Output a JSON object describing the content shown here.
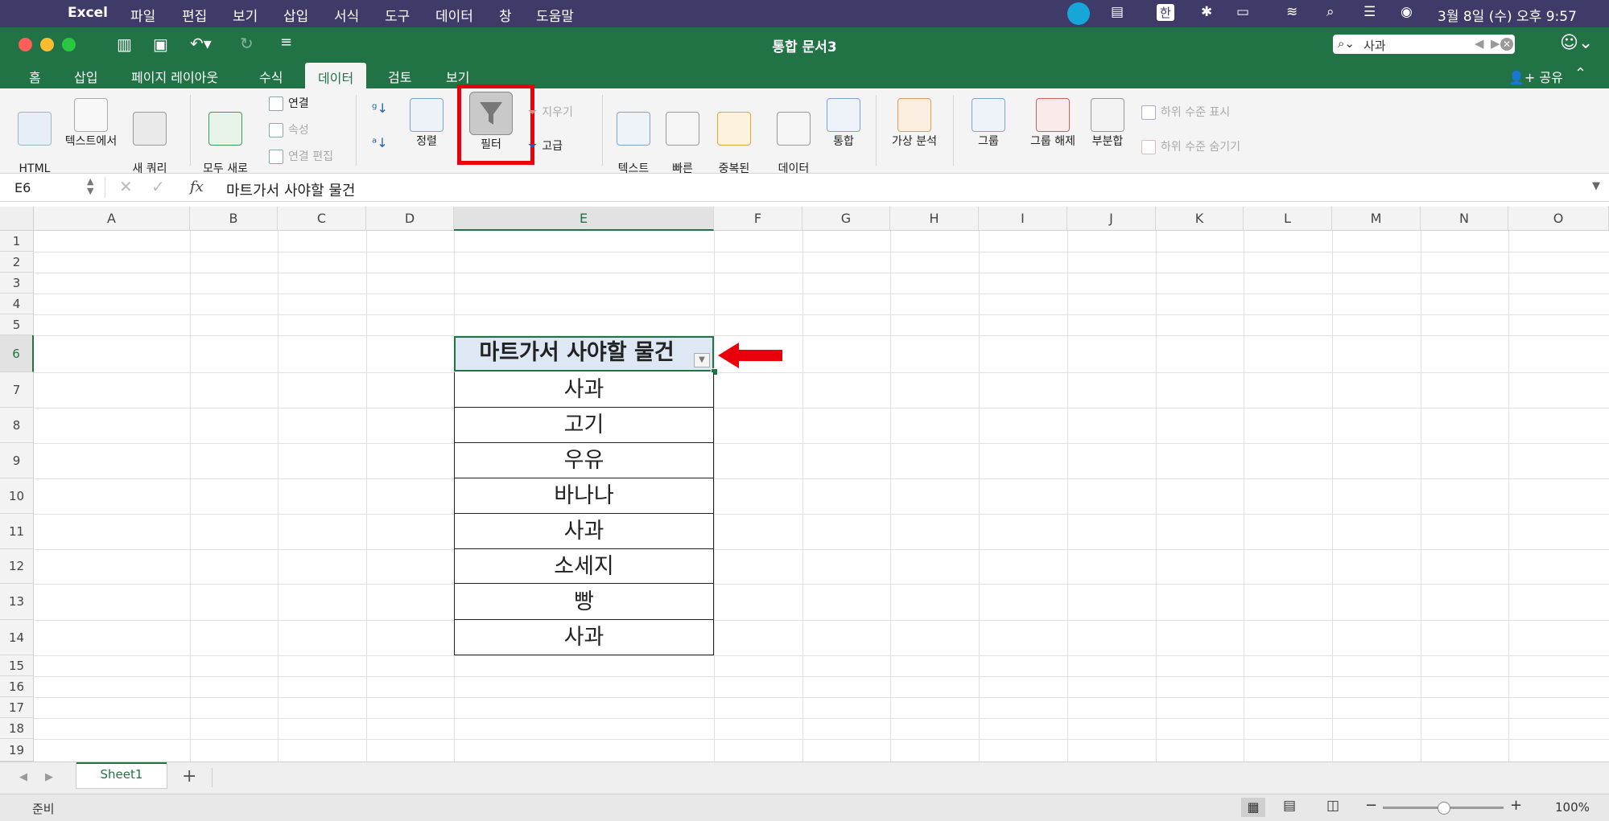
{
  "menubar": {
    "apple": "",
    "app": "Excel",
    "items": [
      "파일",
      "편집",
      "보기",
      "삽입",
      "서식",
      "도구",
      "데이터",
      "창",
      "도움말"
    ],
    "input_icon_label": "한",
    "clock": "3월 8일 (수) 오후 9:57"
  },
  "window": {
    "title": "통합 문서3",
    "search_value": "사과"
  },
  "tabs": {
    "items": [
      "홈",
      "삽입",
      "페이지 레이아웃",
      "수식",
      "데이터",
      "검토",
      "보기"
    ],
    "active": "데이터",
    "share_label": "공유"
  },
  "ribbon": {
    "html_label": "HTML\n에서",
    "text_label": "텍스트에서",
    "new_query_label": "새 쿼리\n만들기",
    "refresh_all_label": "모두 새로\n고침",
    "connections_label": "연결",
    "properties_label": "속성",
    "edit_links_label": "연결 편집",
    "sort_label": "정렬",
    "filter_label": "필터",
    "clear_label": "지우기",
    "advanced_label": "고급",
    "text_to_columns_label": "텍스트\n나누기",
    "flash_fill_label": "빠른\n채우기",
    "remove_duplicates_label": "중복된\n항목 제거",
    "data_validation_label": "데이터\n유효성",
    "consolidate_label": "통합",
    "what_if_label": "가상 분석",
    "group_label": "그룹",
    "ungroup_label": "그룹 해제",
    "subtotal_label": "부분합",
    "show_detail_label": "하위 수준 표시",
    "hide_detail_label": "하위 수준 숨기기"
  },
  "formula_bar": {
    "name_box": "E6",
    "fx": "fx",
    "value": "마트가서 사야할 물건"
  },
  "grid": {
    "columns": [
      "A",
      "B",
      "C",
      "D",
      "E",
      "F",
      "G",
      "H",
      "I",
      "J",
      "K",
      "L",
      "M",
      "N",
      "O"
    ],
    "selected_column": "E",
    "rows": [
      "1",
      "2",
      "3",
      "4",
      "5",
      "6",
      "7",
      "8",
      "9",
      "10",
      "11",
      "12",
      "13",
      "14",
      "15",
      "16",
      "17",
      "18",
      "19"
    ],
    "selected_row": "6",
    "header_cell": "마트가서 사야할 물건",
    "items": [
      "사과",
      "고기",
      "우유",
      "바나나",
      "사과",
      "소세지",
      "빵",
      "사과"
    ]
  },
  "sheets": {
    "tabs": [
      "Sheet1"
    ],
    "add": "+"
  },
  "status": {
    "ready": "준비",
    "zoom_minus": "−",
    "zoom_plus": "+",
    "zoom": "100%",
    "zoom_level_fraction": 0.5
  },
  "colors": {
    "excel_green": "#217346",
    "menubar": "#3e3b69",
    "highlight_red": "#e8000b"
  }
}
